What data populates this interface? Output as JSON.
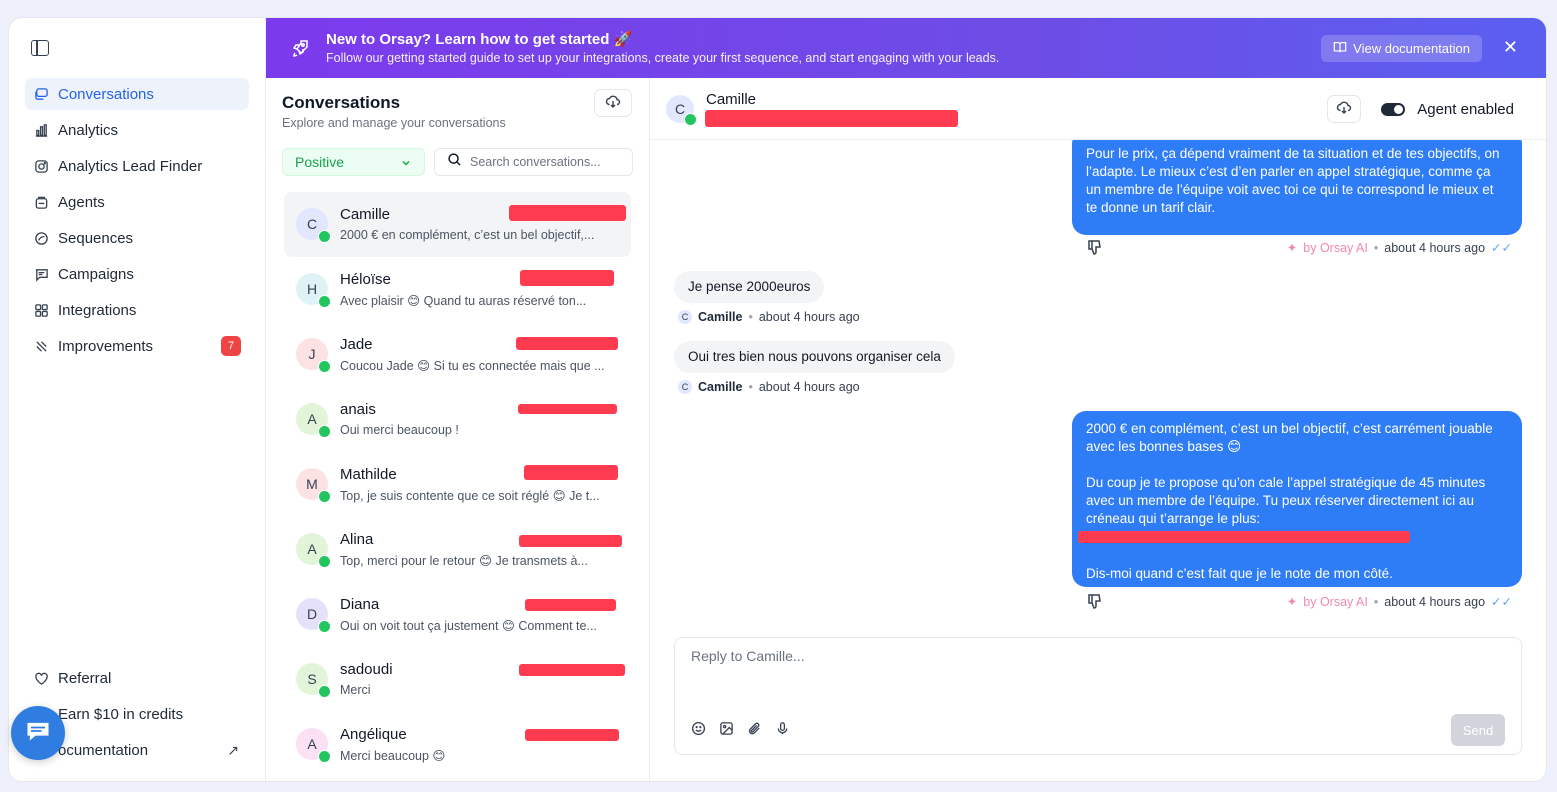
{
  "banner": {
    "title": "New to Orsay? Learn how to get started 🚀",
    "subtitle": "Follow our getting started guide to set up your integrations, create your first sequence, and start engaging with your leads.",
    "button_label": "View documentation",
    "close_label": "✕"
  },
  "sidebar": {
    "items": [
      {
        "label": "Conversations",
        "icon": "chat-icon",
        "active": true
      },
      {
        "label": "Analytics",
        "icon": "bar-chart-icon"
      },
      {
        "label": "Analytics Lead Finder",
        "icon": "instagram-icon"
      },
      {
        "label": "Agents",
        "icon": "bot-icon"
      },
      {
        "label": "Sequences",
        "icon": "sequence-icon"
      },
      {
        "label": "Campaigns",
        "icon": "campaign-icon"
      },
      {
        "label": "Integrations",
        "icon": "grid-icon"
      },
      {
        "label": "Improvements",
        "icon": "tools-icon",
        "badge": "7"
      }
    ],
    "bottom": [
      {
        "label": "Referral",
        "icon": "heart-icon"
      },
      {
        "label": "Earn $10 in credits",
        "icon": "gift-icon"
      },
      {
        "label": "ocumentation",
        "icon": "book-icon",
        "external": "↗"
      }
    ]
  },
  "list": {
    "title": "Conversations",
    "subtitle": "Explore and manage your conversations",
    "filter_value": "Positive",
    "search_placeholder": "Search conversations...",
    "conversations": [
      {
        "initial": "C",
        "name": "Camille",
        "preview": "2000 € en complément, c’est un bel objectif,...",
        "avatar_color": "#e0e7ff",
        "selected": true
      },
      {
        "initial": "H",
        "name": "Héloïse",
        "preview": "Avec plaisir 😊 Quand tu auras réservé ton...",
        "avatar_color": "#dff3f7"
      },
      {
        "initial": "J",
        "name": "Jade",
        "preview": "Coucou Jade 😊 Si tu es connectée mais que ...",
        "avatar_color": "#fde2e4"
      },
      {
        "initial": "A",
        "name": "anais",
        "preview": "Oui merci beaucoup !",
        "avatar_color": "#e3f5d9"
      },
      {
        "initial": "M",
        "name": "Mathilde",
        "preview": "Top, je suis contente que ce soit réglé 😊 Je t...",
        "avatar_color": "#fde2e4"
      },
      {
        "initial": "A",
        "name": "Alina",
        "preview": "Top, merci pour le retour 😊 Je transmets à...",
        "avatar_color": "#e3f5d9"
      },
      {
        "initial": "D",
        "name": "Diana",
        "preview": "Oui on voit tout ça justement 😊 Comment te...",
        "avatar_color": "#e6e1fb"
      },
      {
        "initial": "S",
        "name": "sadoudi",
        "preview": "Merci",
        "avatar_color": "#e3f5d9"
      },
      {
        "initial": "A",
        "name": "Angélique",
        "preview": "Merci beaucoup 😊",
        "avatar_color": "#fbe1f3"
      }
    ]
  },
  "chat": {
    "contact_initial": "C",
    "contact_name": "Camille",
    "agent_label": "Agent enabled",
    "messages": {
      "out1": [
        "Pour le prix, ça dépend vraiment de ta situation et de tes objectifs, on l’adapte. Le mieux c’est d’en parler en appel stratégique, comme ça un membre de l’équipe voit avec toi ce qui te correspond le mieux et te donne un tarif clair."
      ],
      "out1_meta": {
        "by": "by Orsay AI",
        "time": "about 4 hours ago"
      },
      "in1": {
        "text": "Je pense 2000euros",
        "author": "Camille",
        "time": "about 4 hours ago"
      },
      "in2": {
        "text": "Oui tres bien nous pouvons organiser cela",
        "author": "Camille",
        "time": "about 4 hours ago"
      },
      "out2_p1": "2000 € en complément, c’est un bel objectif, c’est carrément jouable avec les bonnes bases 😊",
      "out2_p2": "Du coup je te propose qu’on cale l’appel stratégique de 45 minutes avec un membre de l’équipe. Tu peux réserver directement ici au créneau qui t’arrange le plus:",
      "out2_p3": "Dis-moi quand c’est fait que je le note de mon côté.",
      "out2_meta": {
        "by": "by Orsay AI",
        "time": "about 4 hours ago"
      }
    },
    "reply_placeholder": "Reply to Camille...",
    "send_label": "Send"
  },
  "colors": {
    "accent": "#2563eb",
    "bubble_out": "#2f7df6",
    "redaction": "#ff3b4f",
    "banner_start": "#7c3aed",
    "banner_end": "#5b5ff0"
  }
}
